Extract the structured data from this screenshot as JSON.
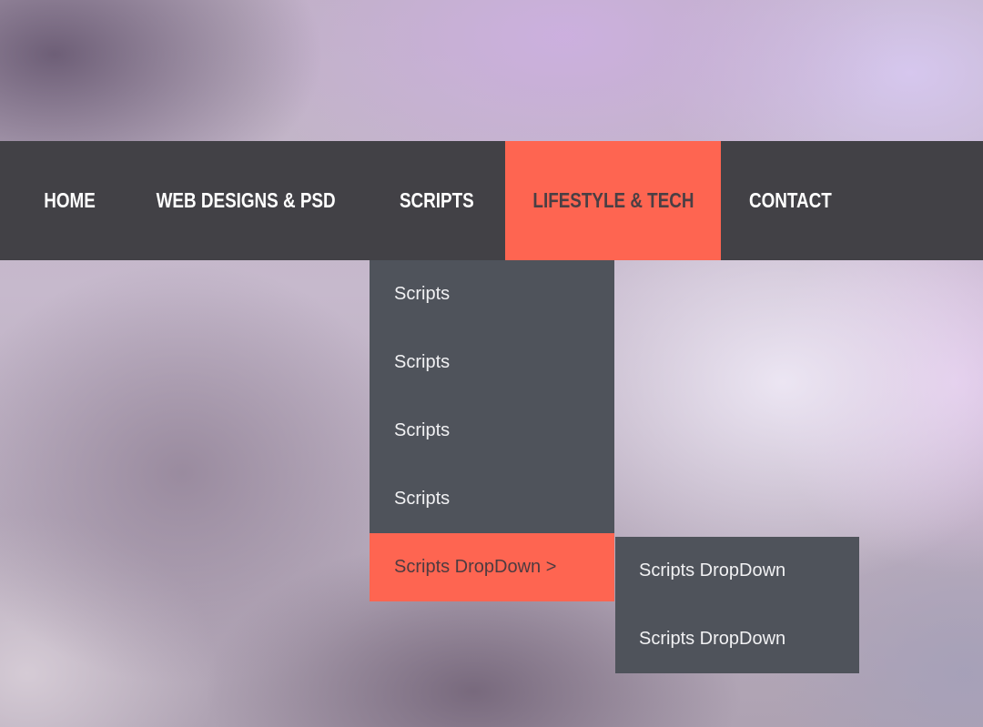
{
  "nav": {
    "items": [
      {
        "label": "HOME"
      },
      {
        "label": "WEB DESIGNS & PSD"
      },
      {
        "label": "SCRIPTS"
      },
      {
        "label": "LIFESTYLE & TECH",
        "active": true
      },
      {
        "label": "CONTACT"
      }
    ]
  },
  "dropdown": {
    "items": [
      {
        "label": "Scripts"
      },
      {
        "label": "Scripts"
      },
      {
        "label": "Scripts"
      },
      {
        "label": "Scripts"
      },
      {
        "label": "Scripts DropDown >",
        "active": true
      }
    ]
  },
  "submenu": {
    "items": [
      {
        "label": "Scripts DropDown"
      },
      {
        "label": "Scripts DropDown"
      }
    ]
  },
  "colors": {
    "navbar_bg": "#424146",
    "accent": "#fe6551",
    "dropdown_bg": "#4f535b",
    "text_light": "#ffffff"
  }
}
